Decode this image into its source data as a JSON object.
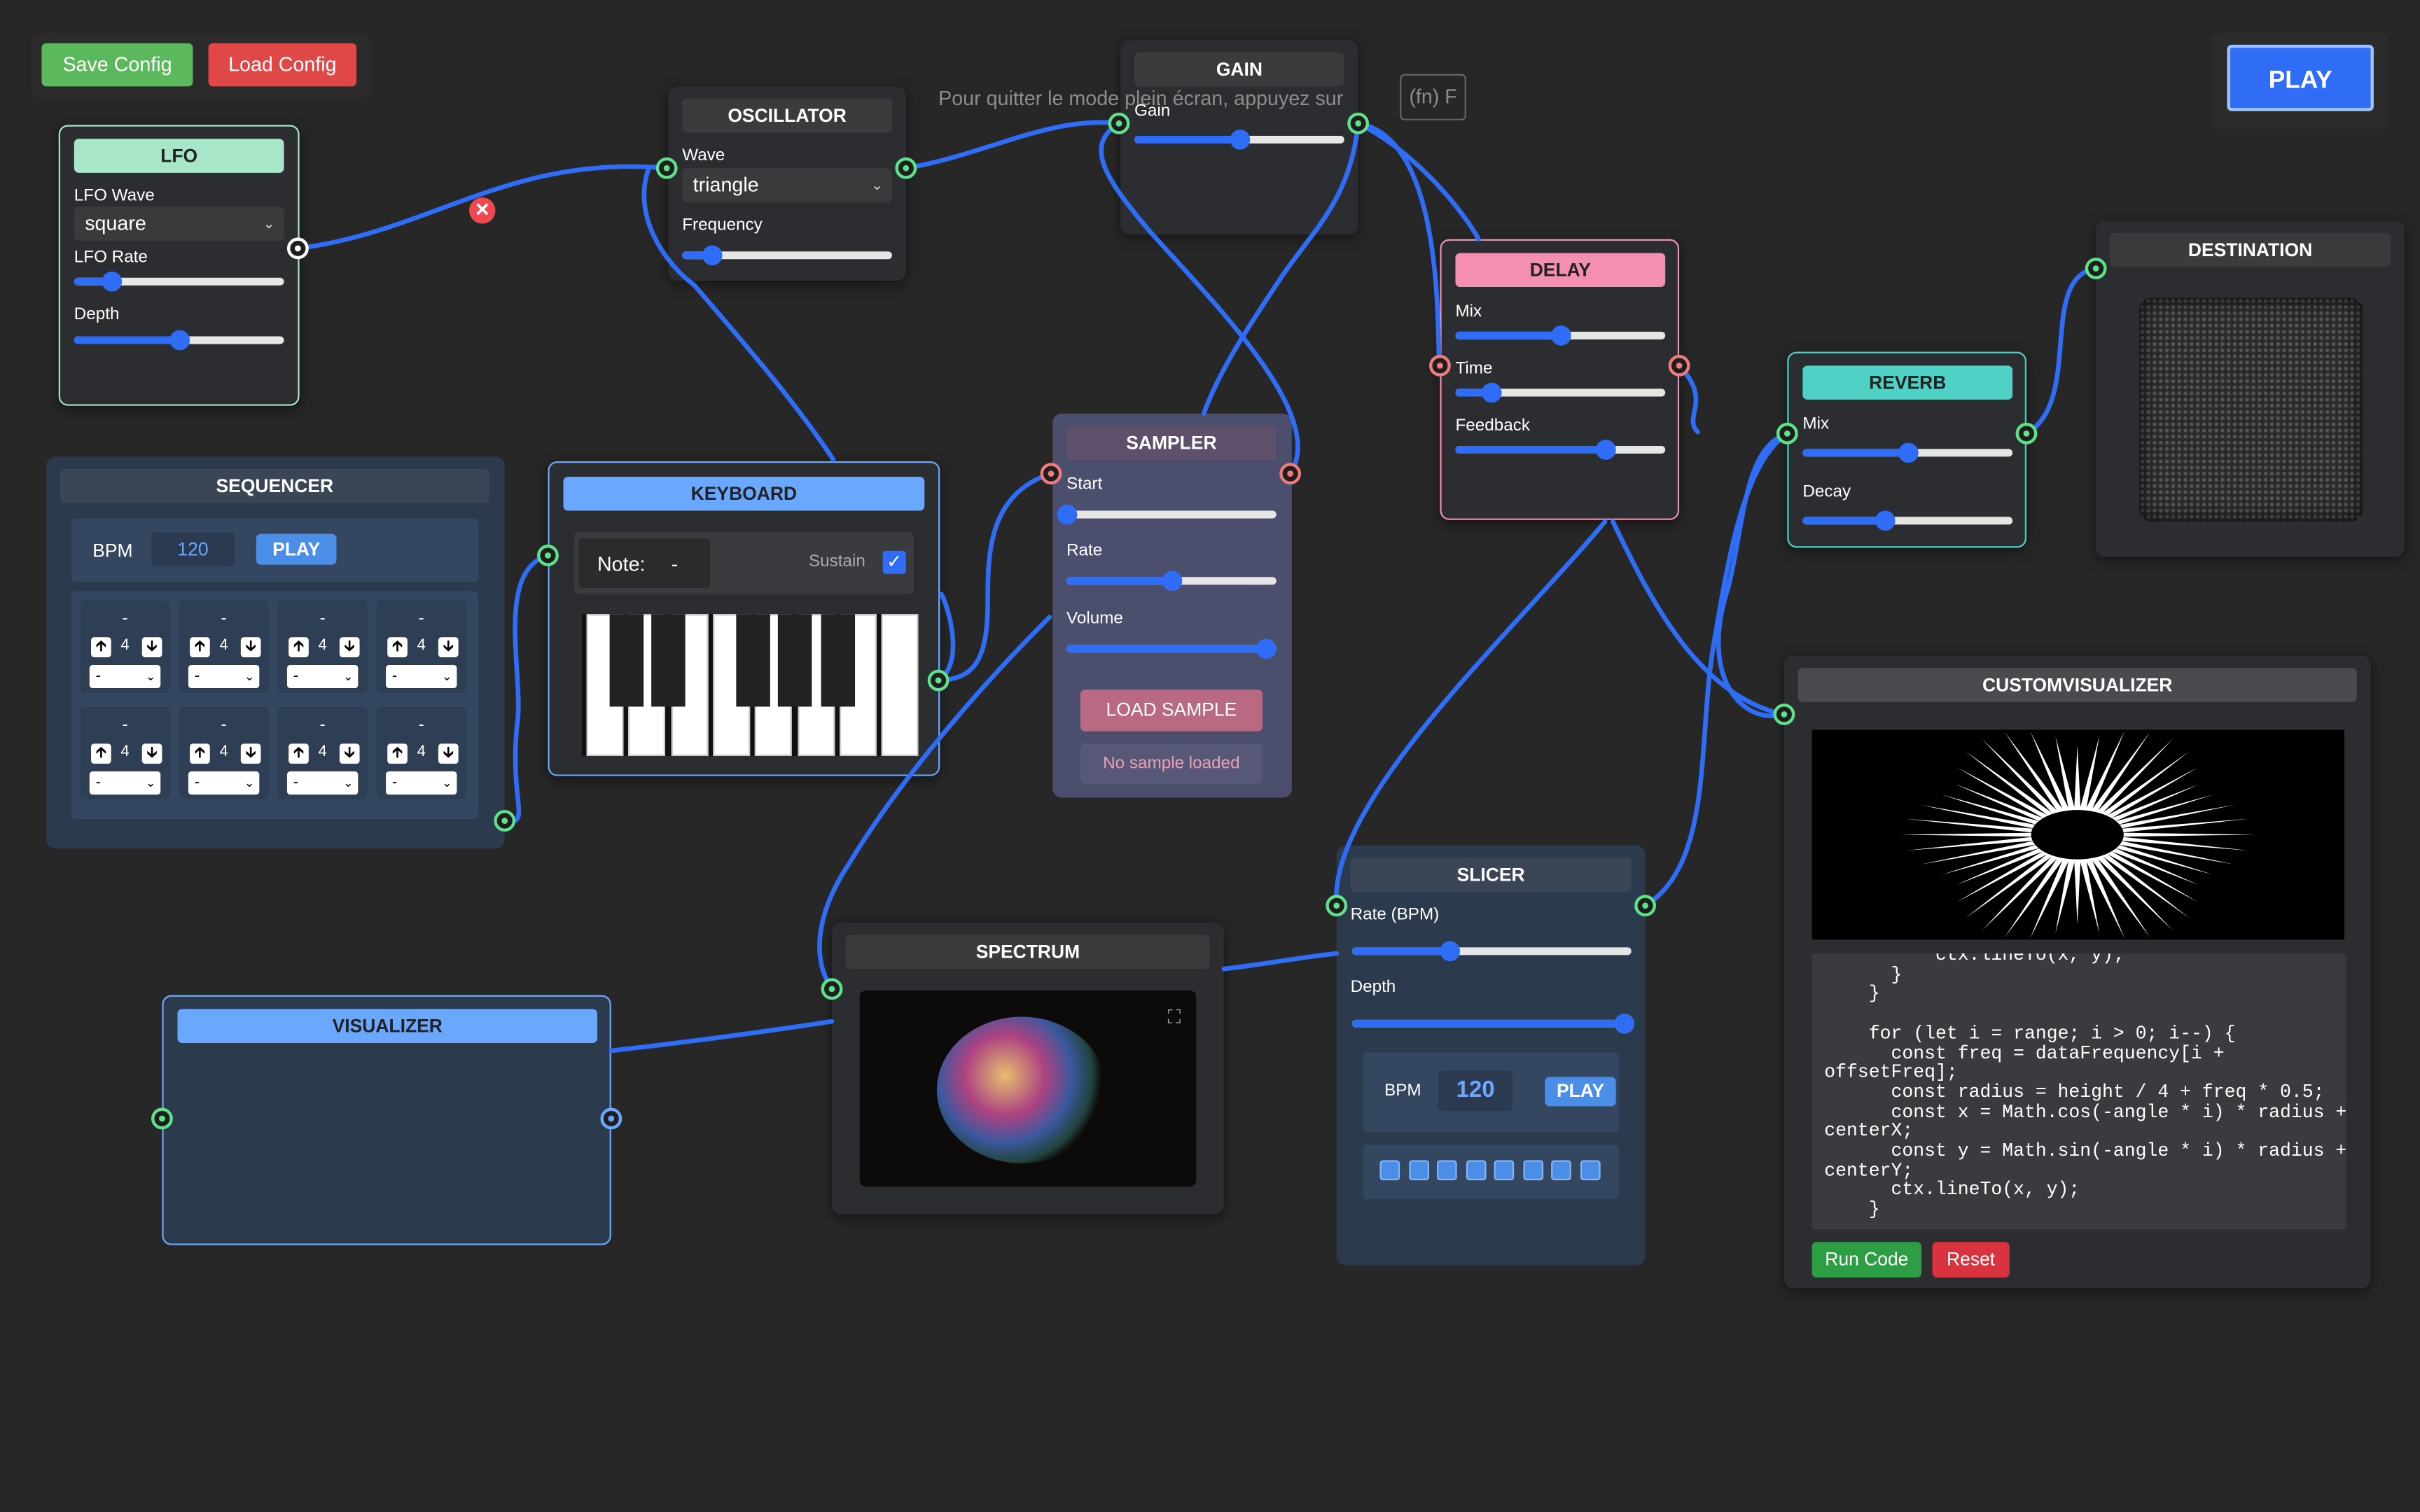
{
  "topbar": {
    "save_label": "Save Config",
    "load_label": "Load Config",
    "play_label": "PLAY"
  },
  "fullscreen_hint": "Pour quitter le mode plein écran, appuyez sur",
  "fullscreen_key": "(fn) F",
  "lfo": {
    "title": "LFO",
    "wave_label": "LFO Wave",
    "wave_value": "square",
    "rate_label": "LFO Rate",
    "rate_value": 0.18,
    "depth_label": "Depth",
    "depth_value": 0.5
  },
  "oscillator": {
    "title": "OSCILLATOR",
    "wave_label": "Wave",
    "wave_value": "triangle",
    "freq_label": "Frequency",
    "freq_value": 0.14
  },
  "gain": {
    "title": "GAIN",
    "gain_label": "Gain",
    "gain_value": 0.5
  },
  "delay": {
    "title": "DELAY",
    "mix_label": "Mix",
    "mix_value": 0.5,
    "time_label": "Time",
    "time_value": 0.17,
    "feedback_label": "Feedback",
    "feedback_value": 0.71
  },
  "reverb": {
    "title": "REVERB",
    "mix_label": "Mix",
    "mix_value": 0.5,
    "decay_label": "Decay",
    "decay_value": 0.39
  },
  "destination": {
    "title": "DESTINATION"
  },
  "sequencer": {
    "title": "SEQUENCER",
    "bpm_label": "BPM",
    "bpm_value": "120",
    "play_label": "PLAY",
    "steps": [
      {
        "note": "-",
        "octave": "4",
        "select": "-"
      },
      {
        "note": "-",
        "octave": "4",
        "select": "-"
      },
      {
        "note": "-",
        "octave": "4",
        "select": "-"
      },
      {
        "note": "-",
        "octave": "4",
        "select": "-"
      },
      {
        "note": "-",
        "octave": "4",
        "select": "-"
      },
      {
        "note": "-",
        "octave": "4",
        "select": "-"
      },
      {
        "note": "-",
        "octave": "4",
        "select": "-"
      },
      {
        "note": "-",
        "octave": "4",
        "select": "-"
      }
    ]
  },
  "keyboard": {
    "title": "KEYBOARD",
    "note_label": "Note:",
    "note_value": "-",
    "sustain_label": "Sustain",
    "sustain_checked": true
  },
  "sampler": {
    "title": "SAMPLER",
    "start_label": "Start",
    "start_value": 0.0,
    "rate_label": "Rate",
    "rate_value": 0.5,
    "volume_label": "Volume",
    "volume_value": 0.95,
    "load_label": "LOAD SAMPLE",
    "status": "No sample loaded"
  },
  "visualizer": {
    "title": "VISUALIZER"
  },
  "spectrum": {
    "title": "SPECTRUM"
  },
  "slicer": {
    "title": "SLICER",
    "rate_label": "Rate (BPM)",
    "rate_value": 0.35,
    "depth_label": "Depth",
    "depth_value": 0.97,
    "bpm_label": "BPM",
    "bpm_value": "120",
    "play_label": "PLAY",
    "pads": 8
  },
  "customvisualizer": {
    "title": "CUSTOMVISUALIZER",
    "code": "          ctx.lineTo(x, y);\n      }\n    }\n\n    for (let i = range; i > 0; i--) {\n      const freq = dataFrequency[i +\noffsetFreq];\n      const radius = height / 4 + freq * 0.5;\n      const x = Math.cos(-angle * i) * radius +\ncenterX;\n      const y = Math.sin(-angle * i) * radius +\ncenterY;\n      ctx.lineTo(x, y);\n    }",
    "run_label": "Run Code",
    "reset_label": "Reset"
  },
  "colors": {
    "background": "#272727",
    "wire": "#2f6df6",
    "lfo_header": "#a8e6c9",
    "delay_header": "#f48fb1",
    "reverb_header": "#4fd1c5",
    "keyboard_header": "#6aa8ff",
    "save_button": "#4caf50",
    "load_button": "#e04848",
    "play_button": "#2f6df6"
  },
  "icons": {
    "disconnect": "close-icon",
    "spectrum_expand": "expand-icon"
  }
}
